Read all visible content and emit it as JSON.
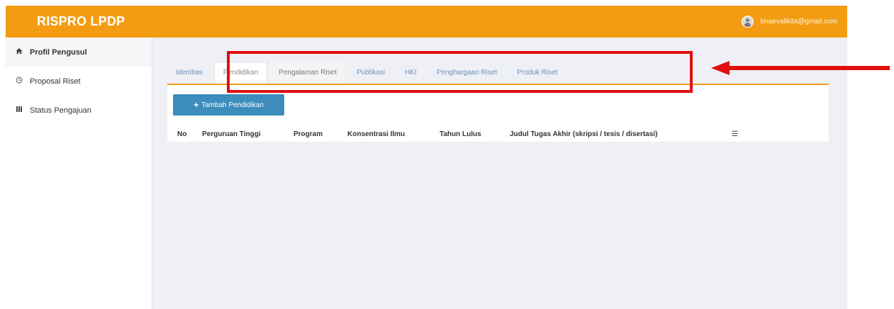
{
  "header": {
    "brand": "RISPRO LPDP",
    "user_email": "bnaevalikita@gmail.com"
  },
  "sidebar": {
    "items": [
      {
        "label": "Profil Pengusul",
        "icon": "home-icon"
      },
      {
        "label": "Proposal Riset",
        "icon": "clock-icon"
      },
      {
        "label": "Status Pengajuan",
        "icon": "list-icon"
      }
    ]
  },
  "tabs": [
    {
      "label": "Identitas"
    },
    {
      "label": "Pendidikan"
    },
    {
      "label": "Pengalaman Riset"
    },
    {
      "label": "Publikasi"
    },
    {
      "label": "HKI"
    },
    {
      "label": "Penghargaan Riset"
    },
    {
      "label": "Produk Riset"
    }
  ],
  "panel": {
    "add_button_label": "Tambah Pendidikan"
  },
  "table": {
    "columns": [
      "No",
      "Perguruan Tinggi",
      "Program",
      "Konsentrasi Ilmu",
      "Tahun Lulus",
      "Judul Tugas Akhir (skripsi / tesis / disertasi)",
      "☰"
    ]
  },
  "annotation": {
    "color": "#e01010"
  },
  "colors": {
    "brand": "#f39c12",
    "button": "#3c8dbc",
    "tab_text": "#6f8fb5"
  }
}
